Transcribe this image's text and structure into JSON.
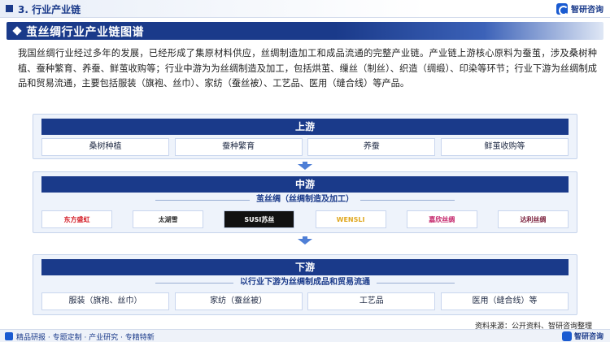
{
  "header": {
    "section_title": "3. 行业产业链",
    "brand_name": "智研咨询"
  },
  "title": "茧丝绸行业产业链图谱",
  "intro": "我国丝绸行业经过多年的发展，已经形成了集原材料供应，丝绸制造加工和成品流通的完整产业链。产业链上游核心原料为蚕茧，涉及桑树种植、蚕种繁育、养蚕、鲜茧收购等；行业中游为为丝绸制造及加工，包括烘茧、缫丝（制丝）、织造（绸缎）、印染等环节；行业下游为丝绸制成品和贸易流通，主要包括服装（旗袍、丝巾）、家纺（蚕丝被）、工艺品、医用（缝合线）等产品。",
  "upstream": {
    "label": "上游",
    "items": [
      "桑树种植",
      "蚕种繁育",
      "养蚕",
      "鲜茧收购等"
    ]
  },
  "midstream": {
    "label": "中游",
    "subtitle": "茧丝绸（丝绸制造及加工）",
    "logos": [
      {
        "name": "东方盛虹",
        "icon": "eastern-shenghong-logo",
        "color": "#d4202a"
      },
      {
        "name": "太湖雪",
        "icon": "taihu-snow-logo",
        "color": "#333333"
      },
      {
        "name": "SUSI苏丝",
        "icon": "susi-logo",
        "color": "#ffffff"
      },
      {
        "name": "WENSLI",
        "icon": "wensli-logo",
        "color": "#e0a820"
      },
      {
        "name": "嘉欣丝绸",
        "icon": "jiaxin-silk-logo",
        "color": "#c4246a"
      },
      {
        "name": "达利丝绸",
        "icon": "dali-silk-logo",
        "color": "#7a1e3a"
      }
    ]
  },
  "downstream": {
    "label": "下游",
    "subtitle": "以行业下游为丝绸制成品和贸易流通",
    "items": [
      "服装（旗袍、丝巾）",
      "家纺（蚕丝被）",
      "工艺品",
      "医用（缝合线）等"
    ]
  },
  "source": "资料来源：公开资料、智研咨询整理",
  "footer": {
    "tagline": "精品研报 · 专题定制 · 产业研究 · 专精特新",
    "brand_name": "智研咨询"
  },
  "colors": {
    "primary": "#1a3a8a",
    "panel": "#eef3fb",
    "arrow": "#4f7fd6"
  }
}
